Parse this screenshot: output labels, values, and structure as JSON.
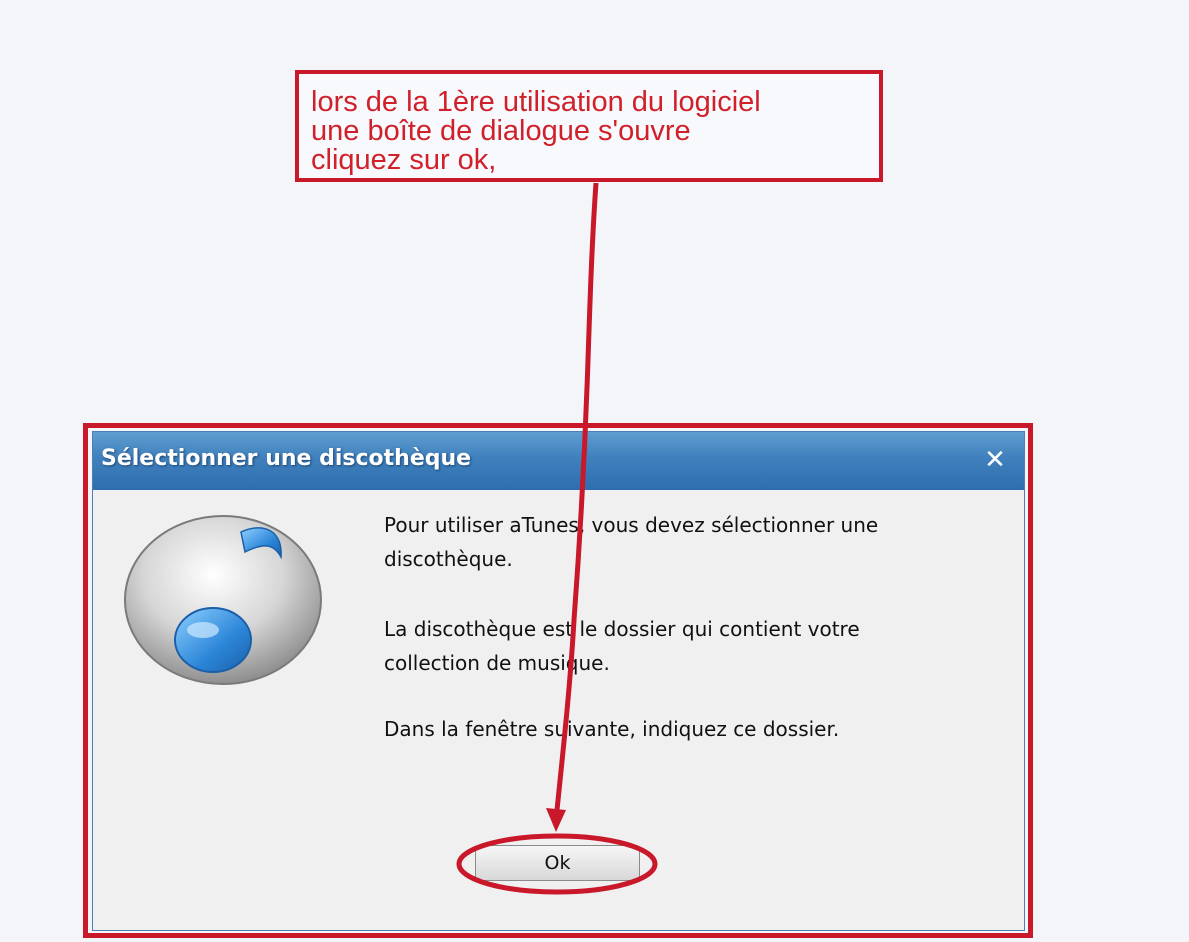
{
  "annotation": {
    "lines": [
      "lors de la 1ère utilisation du logiciel",
      "une boîte de dialogue s'ouvre",
      "cliquez sur ok,"
    ]
  },
  "dialog": {
    "title": "Sélectionner une discothèque",
    "close_glyph": "✕",
    "paragraphs": [
      [
        "Pour utiliser aTunes, vous devez sélectionner une",
        "discothèque."
      ],
      [
        "La discothèque est le dossier qui contient votre",
        "collection de musique."
      ],
      [
        "Dans la fenêtre suivante, indiquez ce dossier."
      ]
    ],
    "ok_label": "Ok",
    "icon": "music-note-icon"
  },
  "colors": {
    "annotation_red": "#c8182a",
    "titlebar_blue": "#3f80bd"
  }
}
